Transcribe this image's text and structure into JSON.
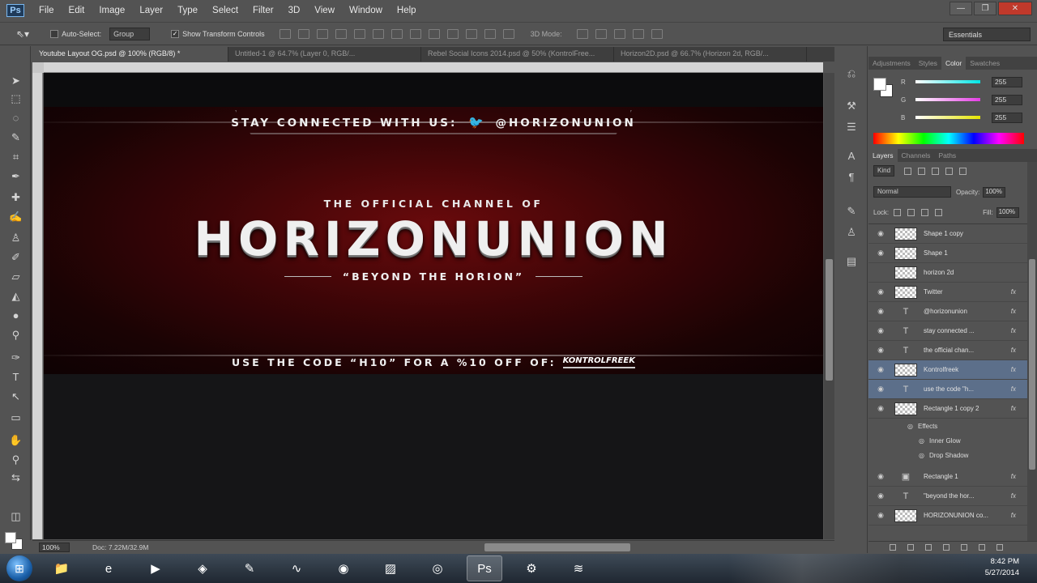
{
  "app": {
    "logo": "Ps"
  },
  "menu": [
    "File",
    "Edit",
    "Image",
    "Layer",
    "Type",
    "Select",
    "Filter",
    "3D",
    "View",
    "Window",
    "Help"
  ],
  "window_controls": {
    "minimize": "—",
    "restore": "❐",
    "close": "✕"
  },
  "options": {
    "tool_icon": "move-tool-icon",
    "auto_select_label": "Auto-Select:",
    "auto_select_value": "Group",
    "show_transform_label": "Show Transform Controls",
    "mode3d_label": "3D Mode:",
    "workspace": "Essentials"
  },
  "tabs": [
    {
      "label": "Youtube Layout OG.psd @ 100% (RGB/8) *"
    },
    {
      "label": "Untitled-1 @ 64.7% (Layer 0, RGB/..."
    },
    {
      "label": "Rebel Social Icons 2014.psd @ 50% (KontrolFree..."
    },
    {
      "label": "Horizon2D.psd @ 66.7% (Horizon 2d, RGB/..."
    }
  ],
  "canvas": {
    "stay_connected": "STAY CONNECTED WITH US:",
    "twitter_handle": "@HORIZONUNION",
    "official": "THE OFFICIAL CHANNEL OF",
    "headline": "HORIZONUNION",
    "tagline": "“BEYOND THE HORION”",
    "code_text": "USE THE CODE “H10” FOR A %10 OFF OF:",
    "sponsor_logo": "KONTROLFREEK"
  },
  "status": {
    "zoom": "100%",
    "doc": "Doc: 7.22M/32.9M"
  },
  "color_panel": {
    "tabs": [
      "Adjustments",
      "Styles",
      "Color",
      "Swatches"
    ],
    "active_tab": "Color",
    "sliders": [
      {
        "label": "R",
        "value": "255",
        "color": "#00e5e5"
      },
      {
        "label": "G",
        "value": "255",
        "color": "#e53ee5"
      },
      {
        "label": "B",
        "value": "255",
        "color": "#e5e500"
      }
    ]
  },
  "layers_panel": {
    "tabs": [
      "Layers",
      "Channels",
      "Paths"
    ],
    "active_tab": "Layers",
    "kind_filter": "Kind",
    "blend_mode": "Normal",
    "opacity_label": "Opacity:",
    "opacity": "100%",
    "lock_label": "Lock:",
    "fill_label": "Fill:",
    "fill": "100%",
    "fx_label": "fx",
    "effects_header": "Effects",
    "layers": [
      {
        "name": "Shape 1 copy",
        "kind": "shape",
        "fx": false
      },
      {
        "name": "Shape 1",
        "kind": "shape",
        "fx": false
      },
      {
        "name": "horizon 2d",
        "kind": "image",
        "fx": false,
        "hidden": true
      },
      {
        "name": "Twitter",
        "kind": "image",
        "fx": true
      },
      {
        "name": "@horizonunion",
        "kind": "text",
        "fx": true
      },
      {
        "name": "stay connected ...",
        "kind": "text",
        "fx": true
      },
      {
        "name": "the official chan...",
        "kind": "text",
        "fx": true
      },
      {
        "name": "Kontrolfreek",
        "kind": "image",
        "fx": true,
        "selected": true
      },
      {
        "name": "use the code \"h...",
        "kind": "text",
        "fx": true,
        "selected": true
      },
      {
        "name": "Rectangle 1 copy 2",
        "kind": "image",
        "fx": true
      }
    ],
    "effects": [
      "Inner Glow",
      "Drop Shadow"
    ],
    "layers_after": [
      {
        "name": "Rectangle 1",
        "kind": "rect",
        "fx": true
      },
      {
        "name": "\"beyond the hor...",
        "kind": "text",
        "fx": true
      },
      {
        "name": "HORIZONUNION co...",
        "kind": "image",
        "fx": true
      }
    ]
  },
  "taskbar": {
    "apps": [
      {
        "name": "explorer",
        "icon": "📁"
      },
      {
        "name": "internet-explorer",
        "icon": "e"
      },
      {
        "name": "media-player",
        "icon": "▶"
      },
      {
        "name": "app-diamond",
        "icon": "◈"
      },
      {
        "name": "feather-app",
        "icon": "✎"
      },
      {
        "name": "audio-app",
        "icon": "∿"
      },
      {
        "name": "firefox",
        "icon": "◉"
      },
      {
        "name": "image-editor",
        "icon": "▨"
      },
      {
        "name": "chrome",
        "icon": "◎"
      },
      {
        "name": "photoshop",
        "icon": "Ps"
      },
      {
        "name": "app-tools",
        "icon": "⚙"
      },
      {
        "name": "spotify",
        "icon": "≋"
      }
    ],
    "time": "8:42 PM",
    "date": "5/27/2014"
  }
}
